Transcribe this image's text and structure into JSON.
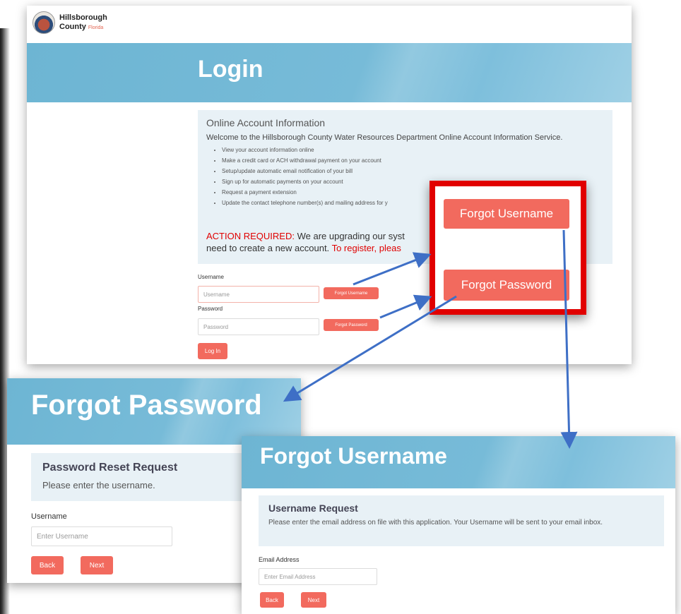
{
  "logo": {
    "line1": "Hillsborough",
    "line2": "County",
    "line2_small": "Florida"
  },
  "login": {
    "title": "Login",
    "info_title": "Online Account Information",
    "welcome": "Welcome to the Hillsborough County Water Resources Department Online Account Information Service.",
    "bullets": [
      "View your account information online",
      "Make a credit card or ACH withdrawal payment on your account",
      "Setup/update automatic email notification of your bill",
      "Sign up for automatic payments on your account",
      "Request a payment extension",
      "Update the contact telephone number(s) and mailing address for y"
    ],
    "action_label": "ACTION REQUIRED:",
    "action_text": " We are upgrading our syst",
    "action_line2": "need to create a new account. ",
    "register_text": "To register, pleas",
    "username_label": "Username",
    "username_placeholder": "Username",
    "forgot_username": "Forgot Username",
    "password_label": "Password",
    "password_placeholder": "Password",
    "forgot_password": "Forgot Password",
    "login_button": "Log In"
  },
  "callout": {
    "forgot_username": "Forgot Username",
    "forgot_password": "Forgot Password"
  },
  "forgot_password_page": {
    "title": "Forgot Password",
    "box_title": "Password Reset Request",
    "box_text": "Please enter the username.",
    "username_label": "Username",
    "username_placeholder": "Enter Username",
    "back": "Back",
    "next": "Next"
  },
  "forgot_username_page": {
    "title": "Forgot Username",
    "box_title": "Username Request",
    "box_text": "Please enter the email address on file with this application. Your Username will be sent to your email inbox.",
    "email_label": "Email Address",
    "email_placeholder": "Enter Email Address",
    "back": "Back",
    "next": "Next"
  },
  "colors": {
    "banner": "#77bbd8",
    "button": "#f26a5e",
    "callout_border": "#e10000",
    "arrow": "#3e6fc6",
    "action": "#e00000"
  }
}
